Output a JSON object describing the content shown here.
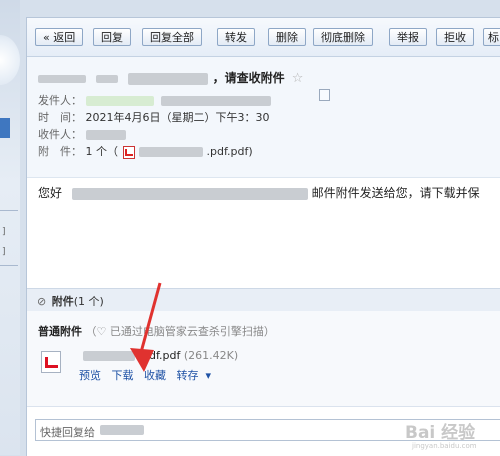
{
  "toolbar": {
    "back": "« 返回",
    "reply": "回复",
    "reply_all": "回复全部",
    "forward": "转发",
    "delete": "删除",
    "delete_permanent": "彻底删除",
    "report": "举报",
    "reject": "拒收",
    "more": "标"
  },
  "mail": {
    "subject_suffix": "，请查收附件",
    "star": "☆",
    "sender_label": "发件人：",
    "time_label": "时　间：",
    "time_value": "2021年4月6日（星期二）下午3：30",
    "recipient_label": "收件人：",
    "attachment_label": "附　件：",
    "attachment_count": "1 个（",
    "attachment_name": ".pdf.pdf)",
    "body_prefix": "您好",
    "body_suffix": "邮件附件发送给您，请下载并保"
  },
  "attachments": {
    "header_title": "附件",
    "header_count": "(1 个)",
    "kind": "普通附件",
    "scan_note": "（♡ 已通过电脑管家云查杀引擎扫描）",
    "file_name": ".pdf.pdf",
    "file_size": "(261.42K)",
    "actions": {
      "preview": "预览",
      "download": "下载",
      "collect": "收藏",
      "save": "转存"
    }
  },
  "reply": {
    "placeholder": "快捷回复给"
  },
  "watermark": {
    "text": "Bai 经验",
    "url": "jingyan.baidu.com"
  },
  "colors": {
    "arrow": "#e0322f",
    "link": "#1f52a5"
  }
}
